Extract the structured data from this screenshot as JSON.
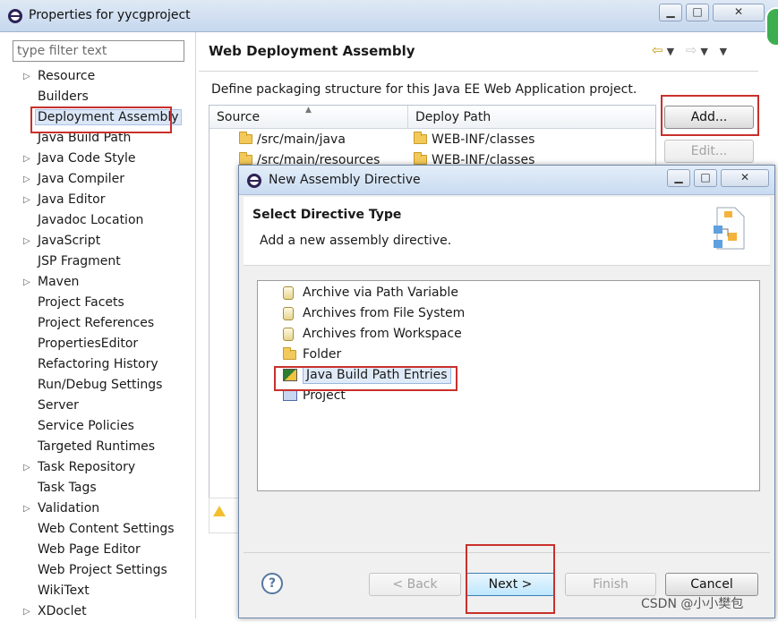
{
  "window": {
    "title": "Properties for yycgproject",
    "controls": {
      "minimize": "▁",
      "maximize": "□",
      "close": "✕"
    }
  },
  "sidebar": {
    "filter_placeholder": "type filter text",
    "items": [
      {
        "label": "Resource",
        "expandable": true
      },
      {
        "label": "Builders",
        "expandable": false
      },
      {
        "label": "Deployment Assembly",
        "expandable": false,
        "selected": true
      },
      {
        "label": "Java Build Path",
        "expandable": false
      },
      {
        "label": "Java Code Style",
        "expandable": true
      },
      {
        "label": "Java Compiler",
        "expandable": true
      },
      {
        "label": "Java Editor",
        "expandable": true
      },
      {
        "label": "Javadoc Location",
        "expandable": false
      },
      {
        "label": "JavaScript",
        "expandable": true
      },
      {
        "label": "JSP Fragment",
        "expandable": false
      },
      {
        "label": "Maven",
        "expandable": true
      },
      {
        "label": "Project Facets",
        "expandable": false
      },
      {
        "label": "Project References",
        "expandable": false
      },
      {
        "label": "PropertiesEditor",
        "expandable": false
      },
      {
        "label": "Refactoring History",
        "expandable": false
      },
      {
        "label": "Run/Debug Settings",
        "expandable": false
      },
      {
        "label": "Server",
        "expandable": false
      },
      {
        "label": "Service Policies",
        "expandable": false
      },
      {
        "label": "Targeted Runtimes",
        "expandable": false
      },
      {
        "label": "Task Repository",
        "expandable": true
      },
      {
        "label": "Task Tags",
        "expandable": false
      },
      {
        "label": "Validation",
        "expandable": true
      },
      {
        "label": "Web Content Settings",
        "expandable": false
      },
      {
        "label": "Web Page Editor",
        "expandable": false
      },
      {
        "label": "Web Project Settings",
        "expandable": false
      },
      {
        "label": "WikiText",
        "expandable": false
      },
      {
        "label": "XDoclet",
        "expandable": true
      }
    ]
  },
  "page": {
    "title": "Web Deployment Assembly",
    "description": "Define packaging structure for this Java EE Web Application project.",
    "table": {
      "columns": [
        "Source",
        "Deploy Path"
      ],
      "rows": [
        {
          "source": "/src/main/java",
          "deploy": "WEB-INF/classes"
        },
        {
          "source": "/src/main/resources",
          "deploy": "WEB-INF/classes"
        }
      ]
    },
    "buttons": {
      "add": "Add...",
      "edit": "Edit..."
    }
  },
  "dialog": {
    "title": "New Assembly Directive",
    "header_title": "Select Directive Type",
    "header_subtitle": "Add a new assembly directive.",
    "items": [
      {
        "label": "Archive via Path Variable",
        "icon": "jar-icon"
      },
      {
        "label": "Archives from File System",
        "icon": "jar-icon"
      },
      {
        "label": "Archives from Workspace",
        "icon": "jar-icon"
      },
      {
        "label": "Folder",
        "icon": "folder-icon"
      },
      {
        "label": "Java Build Path Entries",
        "icon": "build-path-icon",
        "selected": true
      },
      {
        "label": "Project",
        "icon": "project-icon"
      }
    ],
    "buttons": {
      "help": "?",
      "back": "< Back",
      "next": "Next >",
      "finish": "Finish",
      "cancel": "Cancel"
    }
  },
  "watermark": "CSDN @小小樊包",
  "colors": {
    "highlight_red": "#c9302c",
    "selection_blue": "#dbe7f7"
  }
}
